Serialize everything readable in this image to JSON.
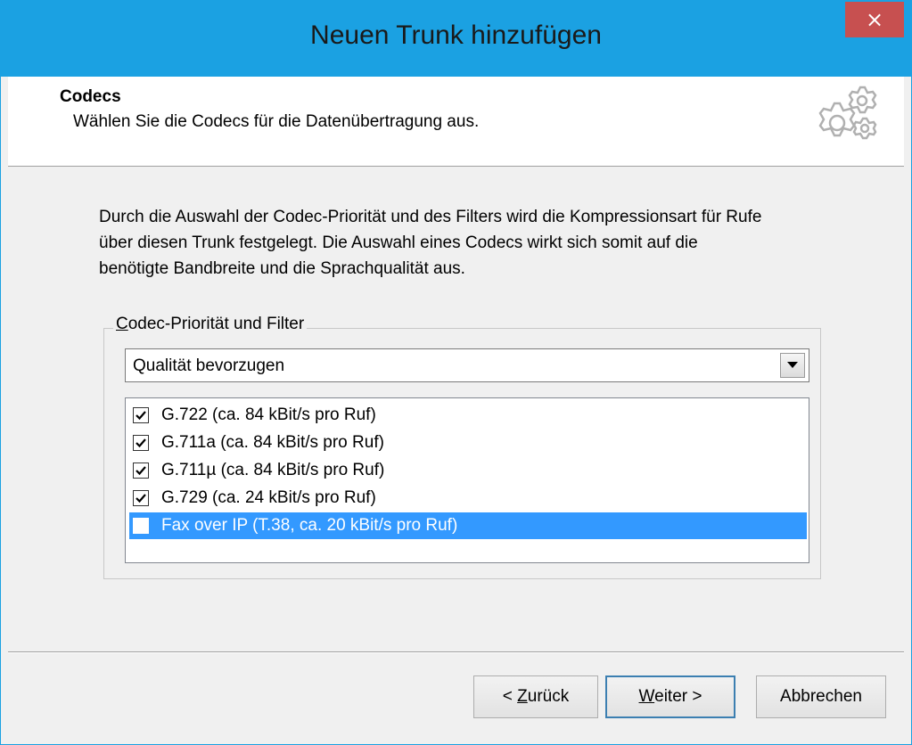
{
  "window": {
    "title": "Neuen Trunk hinzufügen",
    "close_label": "×",
    "accent": "#1ba1e2"
  },
  "header": {
    "title": "Codecs",
    "subtitle": "Wählen Sie die Codecs für die Datenübertragung aus.",
    "icon": "gears-icon"
  },
  "description": {
    "line1": "Durch die Auswahl der Codec-Priorität und des Filters wird die Kompressionsart für Rufe",
    "line2": "über diesen Trunk festgelegt. Die Auswahl eines Codecs wirkt sich somit auf die",
    "line3": "benötigte Bandbreite und die Sprachqualität aus."
  },
  "group": {
    "legend_accel": "C",
    "legend_rest": "odec-Priorität und Filter",
    "combo_value": "Qualität bevorzugen",
    "codecs": [
      {
        "label": "G.722 (ca. 84 kBit/s pro Ruf)",
        "checked": true,
        "selected": false
      },
      {
        "label": "G.711a (ca. 84 kBit/s pro Ruf)",
        "checked": true,
        "selected": false
      },
      {
        "label": "G.711µ (ca. 84 kBit/s pro Ruf)",
        "checked": true,
        "selected": false
      },
      {
        "label": "G.729 (ca. 24 kBit/s pro Ruf)",
        "checked": true,
        "selected": false
      },
      {
        "label": "Fax over IP (T.38, ca. 20 kBit/s pro Ruf)",
        "checked": false,
        "selected": true
      }
    ]
  },
  "buttons": {
    "back_prefix": "< ",
    "back_accel": "Z",
    "back_rest": "urück",
    "next_accel": "W",
    "next_rest": "eiter >",
    "cancel": "Abbrechen"
  }
}
